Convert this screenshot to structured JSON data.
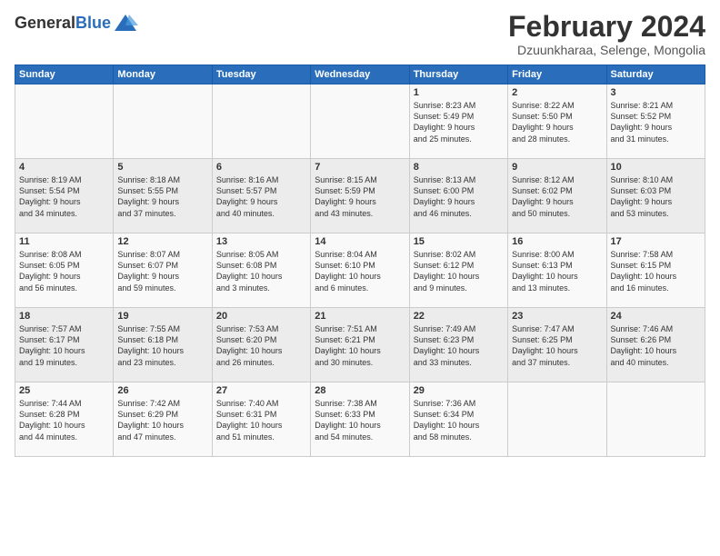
{
  "logo": {
    "general": "General",
    "blue": "Blue"
  },
  "title": "February 2024",
  "location": "Dzuunkharaa, Selenge, Mongolia",
  "headers": [
    "Sunday",
    "Monday",
    "Tuesday",
    "Wednesday",
    "Thursday",
    "Friday",
    "Saturday"
  ],
  "weeks": [
    [
      {
        "day": "",
        "content": ""
      },
      {
        "day": "",
        "content": ""
      },
      {
        "day": "",
        "content": ""
      },
      {
        "day": "",
        "content": ""
      },
      {
        "day": "1",
        "content": "Sunrise: 8:23 AM\nSunset: 5:49 PM\nDaylight: 9 hours\nand 25 minutes."
      },
      {
        "day": "2",
        "content": "Sunrise: 8:22 AM\nSunset: 5:50 PM\nDaylight: 9 hours\nand 28 minutes."
      },
      {
        "day": "3",
        "content": "Sunrise: 8:21 AM\nSunset: 5:52 PM\nDaylight: 9 hours\nand 31 minutes."
      }
    ],
    [
      {
        "day": "4",
        "content": "Sunrise: 8:19 AM\nSunset: 5:54 PM\nDaylight: 9 hours\nand 34 minutes."
      },
      {
        "day": "5",
        "content": "Sunrise: 8:18 AM\nSunset: 5:55 PM\nDaylight: 9 hours\nand 37 minutes."
      },
      {
        "day": "6",
        "content": "Sunrise: 8:16 AM\nSunset: 5:57 PM\nDaylight: 9 hours\nand 40 minutes."
      },
      {
        "day": "7",
        "content": "Sunrise: 8:15 AM\nSunset: 5:59 PM\nDaylight: 9 hours\nand 43 minutes."
      },
      {
        "day": "8",
        "content": "Sunrise: 8:13 AM\nSunset: 6:00 PM\nDaylight: 9 hours\nand 46 minutes."
      },
      {
        "day": "9",
        "content": "Sunrise: 8:12 AM\nSunset: 6:02 PM\nDaylight: 9 hours\nand 50 minutes."
      },
      {
        "day": "10",
        "content": "Sunrise: 8:10 AM\nSunset: 6:03 PM\nDaylight: 9 hours\nand 53 minutes."
      }
    ],
    [
      {
        "day": "11",
        "content": "Sunrise: 8:08 AM\nSunset: 6:05 PM\nDaylight: 9 hours\nand 56 minutes."
      },
      {
        "day": "12",
        "content": "Sunrise: 8:07 AM\nSunset: 6:07 PM\nDaylight: 9 hours\nand 59 minutes."
      },
      {
        "day": "13",
        "content": "Sunrise: 8:05 AM\nSunset: 6:08 PM\nDaylight: 10 hours\nand 3 minutes."
      },
      {
        "day": "14",
        "content": "Sunrise: 8:04 AM\nSunset: 6:10 PM\nDaylight: 10 hours\nand 6 minutes."
      },
      {
        "day": "15",
        "content": "Sunrise: 8:02 AM\nSunset: 6:12 PM\nDaylight: 10 hours\nand 9 minutes."
      },
      {
        "day": "16",
        "content": "Sunrise: 8:00 AM\nSunset: 6:13 PM\nDaylight: 10 hours\nand 13 minutes."
      },
      {
        "day": "17",
        "content": "Sunrise: 7:58 AM\nSunset: 6:15 PM\nDaylight: 10 hours\nand 16 minutes."
      }
    ],
    [
      {
        "day": "18",
        "content": "Sunrise: 7:57 AM\nSunset: 6:17 PM\nDaylight: 10 hours\nand 19 minutes."
      },
      {
        "day": "19",
        "content": "Sunrise: 7:55 AM\nSunset: 6:18 PM\nDaylight: 10 hours\nand 23 minutes."
      },
      {
        "day": "20",
        "content": "Sunrise: 7:53 AM\nSunset: 6:20 PM\nDaylight: 10 hours\nand 26 minutes."
      },
      {
        "day": "21",
        "content": "Sunrise: 7:51 AM\nSunset: 6:21 PM\nDaylight: 10 hours\nand 30 minutes."
      },
      {
        "day": "22",
        "content": "Sunrise: 7:49 AM\nSunset: 6:23 PM\nDaylight: 10 hours\nand 33 minutes."
      },
      {
        "day": "23",
        "content": "Sunrise: 7:47 AM\nSunset: 6:25 PM\nDaylight: 10 hours\nand 37 minutes."
      },
      {
        "day": "24",
        "content": "Sunrise: 7:46 AM\nSunset: 6:26 PM\nDaylight: 10 hours\nand 40 minutes."
      }
    ],
    [
      {
        "day": "25",
        "content": "Sunrise: 7:44 AM\nSunset: 6:28 PM\nDaylight: 10 hours\nand 44 minutes."
      },
      {
        "day": "26",
        "content": "Sunrise: 7:42 AM\nSunset: 6:29 PM\nDaylight: 10 hours\nand 47 minutes."
      },
      {
        "day": "27",
        "content": "Sunrise: 7:40 AM\nSunset: 6:31 PM\nDaylight: 10 hours\nand 51 minutes."
      },
      {
        "day": "28",
        "content": "Sunrise: 7:38 AM\nSunset: 6:33 PM\nDaylight: 10 hours\nand 54 minutes."
      },
      {
        "day": "29",
        "content": "Sunrise: 7:36 AM\nSunset: 6:34 PM\nDaylight: 10 hours\nand 58 minutes."
      },
      {
        "day": "",
        "content": ""
      },
      {
        "day": "",
        "content": ""
      }
    ]
  ]
}
